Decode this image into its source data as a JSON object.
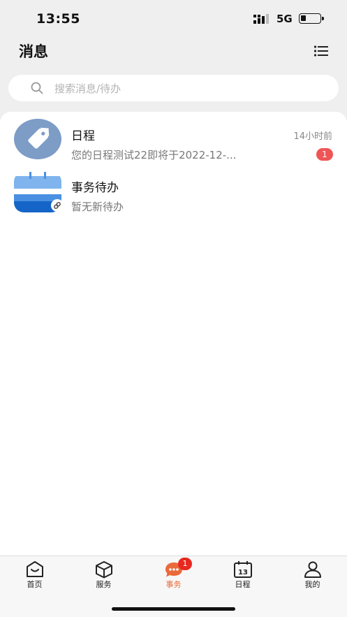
{
  "status_bar": {
    "time": "13:55",
    "network": "5G"
  },
  "header": {
    "title": "消息",
    "menu_icon": "list-icon"
  },
  "search": {
    "placeholder": "搜索消息/待办"
  },
  "messages": [
    {
      "title": "日程",
      "preview": "您的日程测试22即将于2022-12-...",
      "time": "14小时前",
      "unread": "1",
      "icon": "tag-icon"
    },
    {
      "title": "事务待办",
      "preview": "暂无新待办",
      "icon": "todo-icon"
    }
  ],
  "tabs": [
    {
      "label": "首页",
      "icon": "home-icon"
    },
    {
      "label": "服务",
      "icon": "box-icon"
    },
    {
      "label": "事务",
      "icon": "chat-icon",
      "badge": "1",
      "active": true
    },
    {
      "label": "日程",
      "icon": "calendar-icon",
      "calendar_day": "13"
    },
    {
      "label": "我的",
      "icon": "user-icon"
    }
  ],
  "colors": {
    "accent": "#e96a3a",
    "badge": "#e8281f",
    "unread_badge": "#ef5555",
    "avatar_blue": "#7d9cc6"
  }
}
